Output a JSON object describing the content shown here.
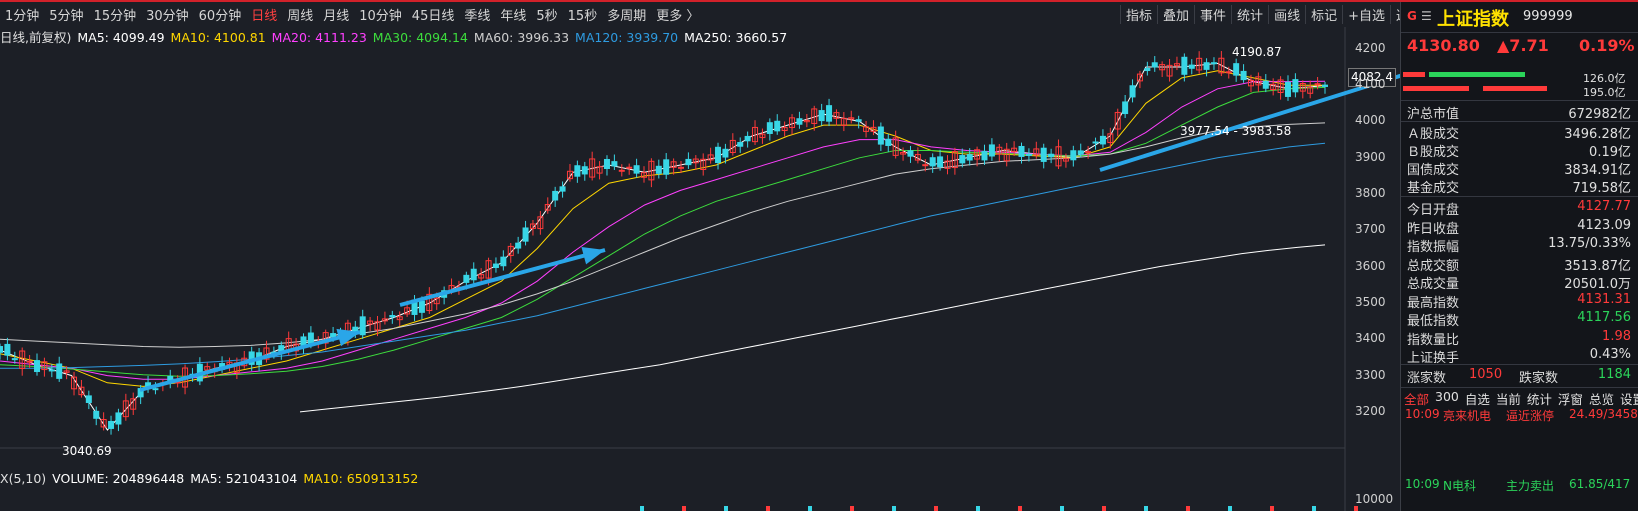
{
  "toolbar": {
    "periods": [
      "1分钟",
      "5分钟",
      "15分钟",
      "30分钟",
      "60分钟",
      "日线",
      "周线",
      "月线",
      "10分钟",
      "45日线",
      "季线",
      "年线",
      "5秒",
      "15秒",
      "多周期",
      "更多 〉"
    ],
    "active_period": "日线",
    "tools": [
      "指标",
      "叠加",
      "事件",
      "统计",
      "画线",
      "标记",
      "+自选",
      "返回"
    ]
  },
  "ma_line": {
    "prefix": "日线,前复权)",
    "items": [
      {
        "label": "MA5: 4099.49",
        "color": "#ffffff"
      },
      {
        "label": "MA10: 4100.81",
        "color": "#ffd700"
      },
      {
        "label": "MA20: 4111.23",
        "color": "#ff40ff"
      },
      {
        "label": "MA30: 4094.14",
        "color": "#3ddc3d"
      },
      {
        "label": "MA60: 3996.33",
        "color": "#cfcfcf"
      },
      {
        "label": "MA120: 3939.70",
        "color": "#2e9be0"
      },
      {
        "label": "MA250: 3660.57",
        "color": "#ffffff"
      }
    ]
  },
  "volume_line": {
    "prefix": "X(5,10)",
    "items": [
      {
        "label": "VOLUME: 204896448",
        "color": "#ffffff"
      },
      {
        "label": "MA5: 521043104",
        "color": "#ffffff"
      },
      {
        "label": "MA10: 650913152",
        "color": "#ffd700"
      }
    ]
  },
  "chart_data": {
    "type": "line",
    "title": "上证指数 日线",
    "y_axis_ticks": [
      "4200",
      "4100",
      "4000",
      "3900",
      "3800",
      "3700",
      "3600",
      "3500",
      "3400",
      "3300",
      "3200"
    ],
    "ylim": [
      3150,
      4230
    ],
    "volume_axis_tick": "10000",
    "current_price_tag": "4082.4",
    "annotations": {
      "high": "4190.87",
      "low": "3040.69",
      "range": "3977.54 - 3983.58"
    },
    "series": [
      {
        "name": "MA5",
        "color": "#ffffff",
        "values": [
          3370,
          3330,
          3300,
          3150,
          3260,
          3290,
          3320,
          3340,
          3380,
          3400,
          3430,
          3460,
          3500,
          3560,
          3610,
          3720,
          3860,
          3880,
          3860,
          3880,
          3900,
          3960,
          3990,
          4020,
          4000,
          3930,
          3880,
          3900,
          3920,
          3910,
          3900,
          3960,
          4150,
          4150,
          4160,
          4110,
          4090,
          4099
        ]
      },
      {
        "name": "MA10",
        "color": "#ffd700",
        "values": [
          3360,
          3340,
          3320,
          3280,
          3270,
          3280,
          3300,
          3320,
          3340,
          3370,
          3400,
          3430,
          3460,
          3510,
          3560,
          3650,
          3760,
          3830,
          3850,
          3860,
          3880,
          3920,
          3960,
          3990,
          3990,
          3960,
          3920,
          3910,
          3910,
          3905,
          3900,
          3930,
          4050,
          4120,
          4140,
          4120,
          4100,
          4100
        ]
      },
      {
        "name": "MA20",
        "color": "#ff40ff",
        "values": [
          3340,
          3330,
          3320,
          3300,
          3290,
          3290,
          3300,
          3310,
          3320,
          3340,
          3370,
          3400,
          3430,
          3460,
          3500,
          3560,
          3640,
          3710,
          3770,
          3810,
          3840,
          3870,
          3900,
          3930,
          3950,
          3950,
          3930,
          3920,
          3915,
          3910,
          3905,
          3915,
          3970,
          4040,
          4090,
          4110,
          4110,
          4111
        ]
      },
      {
        "name": "MA30",
        "color": "#3ddc3d",
        "values": [
          3330,
          3325,
          3318,
          3310,
          3302,
          3298,
          3300,
          3305,
          3312,
          3325,
          3345,
          3370,
          3400,
          3430,
          3460,
          3510,
          3570,
          3630,
          3690,
          3740,
          3780,
          3810,
          3840,
          3870,
          3900,
          3920,
          3920,
          3915,
          3912,
          3908,
          3905,
          3910,
          3940,
          3990,
          4040,
          4080,
          4090,
          4094
        ]
      },
      {
        "name": "MA60",
        "color": "#cfcfcf",
        "values": [
          3400,
          3395,
          3390,
          3385,
          3380,
          3378,
          3380,
          3383,
          3390,
          3400,
          3415,
          3430,
          3450,
          3470,
          3495,
          3525,
          3560,
          3600,
          3640,
          3680,
          3715,
          3750,
          3780,
          3805,
          3830,
          3855,
          3870,
          3880,
          3890,
          3895,
          3900,
          3910,
          3930,
          3955,
          3975,
          3985,
          3992,
          3996
        ]
      },
      {
        "name": "MA120",
        "color": "#2e9be0",
        "values": [
          3320,
          3320,
          3322,
          3325,
          3328,
          3332,
          3338,
          3345,
          3355,
          3365,
          3380,
          3395,
          3410,
          3425,
          3445,
          3465,
          3490,
          3515,
          3540,
          3565,
          3590,
          3615,
          3640,
          3665,
          3690,
          3715,
          3740,
          3760,
          3780,
          3800,
          3820,
          3840,
          3860,
          3880,
          3900,
          3915,
          3930,
          3940
        ]
      },
      {
        "name": "MA250",
        "color": "#ffffff",
        "values": [
          3200,
          3208,
          3216,
          3224,
          3232,
          3240,
          3250,
          3260,
          3270,
          3282,
          3294,
          3306,
          3318,
          3330,
          3345,
          3360,
          3375,
          3390,
          3405,
          3420,
          3435,
          3450,
          3465,
          3480,
          3495,
          3510,
          3525,
          3540,
          3555,
          3570,
          3585,
          3600,
          3612,
          3624,
          3636,
          3645,
          3653,
          3660
        ]
      }
    ]
  },
  "arrows": {
    "color": "#2aa6e8"
  },
  "panel": {
    "name": "上证指数",
    "code": "999999",
    "price": "4130.80",
    "change": "▲7.71",
    "change_pct": "0.19%",
    "bar_values": [
      "126.0亿",
      "195.0亿"
    ],
    "market_cap": {
      "k": "沪总市值",
      "v": "672982亿"
    },
    "turnovers": [
      {
        "k": "Ａ股成交",
        "v": "3496.28亿",
        "color": "#e0e0e0"
      },
      {
        "k": "Ｂ股成交",
        "v": "0.19亿",
        "color": "#e0e0e0"
      },
      {
        "k": "国债成交",
        "v": "3834.91亿",
        "color": "#e0e0e0"
      },
      {
        "k": "基金成交",
        "v": "719.58亿",
        "color": "#e0e0e0"
      }
    ],
    "stats": [
      {
        "k": "今日开盘",
        "v": "4127.77",
        "color": "#ff3a3a"
      },
      {
        "k": "昨日收盘",
        "v": "4123.09",
        "color": "#e0e0e0"
      },
      {
        "k": "指数振幅",
        "v": "13.75/0.33%",
        "color": "#e0e0e0"
      },
      {
        "k": "总成交额",
        "v": "3513.87亿",
        "color": "#e0e0e0"
      },
      {
        "k": "总成交量",
        "v": "20501.0万",
        "color": "#e0e0e0"
      },
      {
        "k": "最高指数",
        "v": "4131.31",
        "color": "#ff3a3a"
      },
      {
        "k": "最低指数",
        "v": "4117.56",
        "color": "#2bd45a"
      },
      {
        "k": "指数量比",
        "v": "1.98",
        "color": "#ff3a3a"
      },
      {
        "k": "上证换手",
        "v": "0.43%",
        "color": "#e0e0e0"
      }
    ],
    "breadth": {
      "up_label": "涨家数",
      "up": "1050",
      "down_label": "跌家数",
      "down": "1184"
    },
    "tabs": [
      "全部",
      "300",
      "自选",
      "当前",
      "统计",
      "浮窗",
      "总览",
      "设置"
    ],
    "news": [
      {
        "time": "10:09",
        "stock": "亮来机电",
        "event": "逼近涨停",
        "value": "24.49/3458"
      },
      {
        "time": "10:09",
        "stock": "N电科",
        "event": "主力卖出",
        "value": "61.85/417"
      }
    ]
  }
}
